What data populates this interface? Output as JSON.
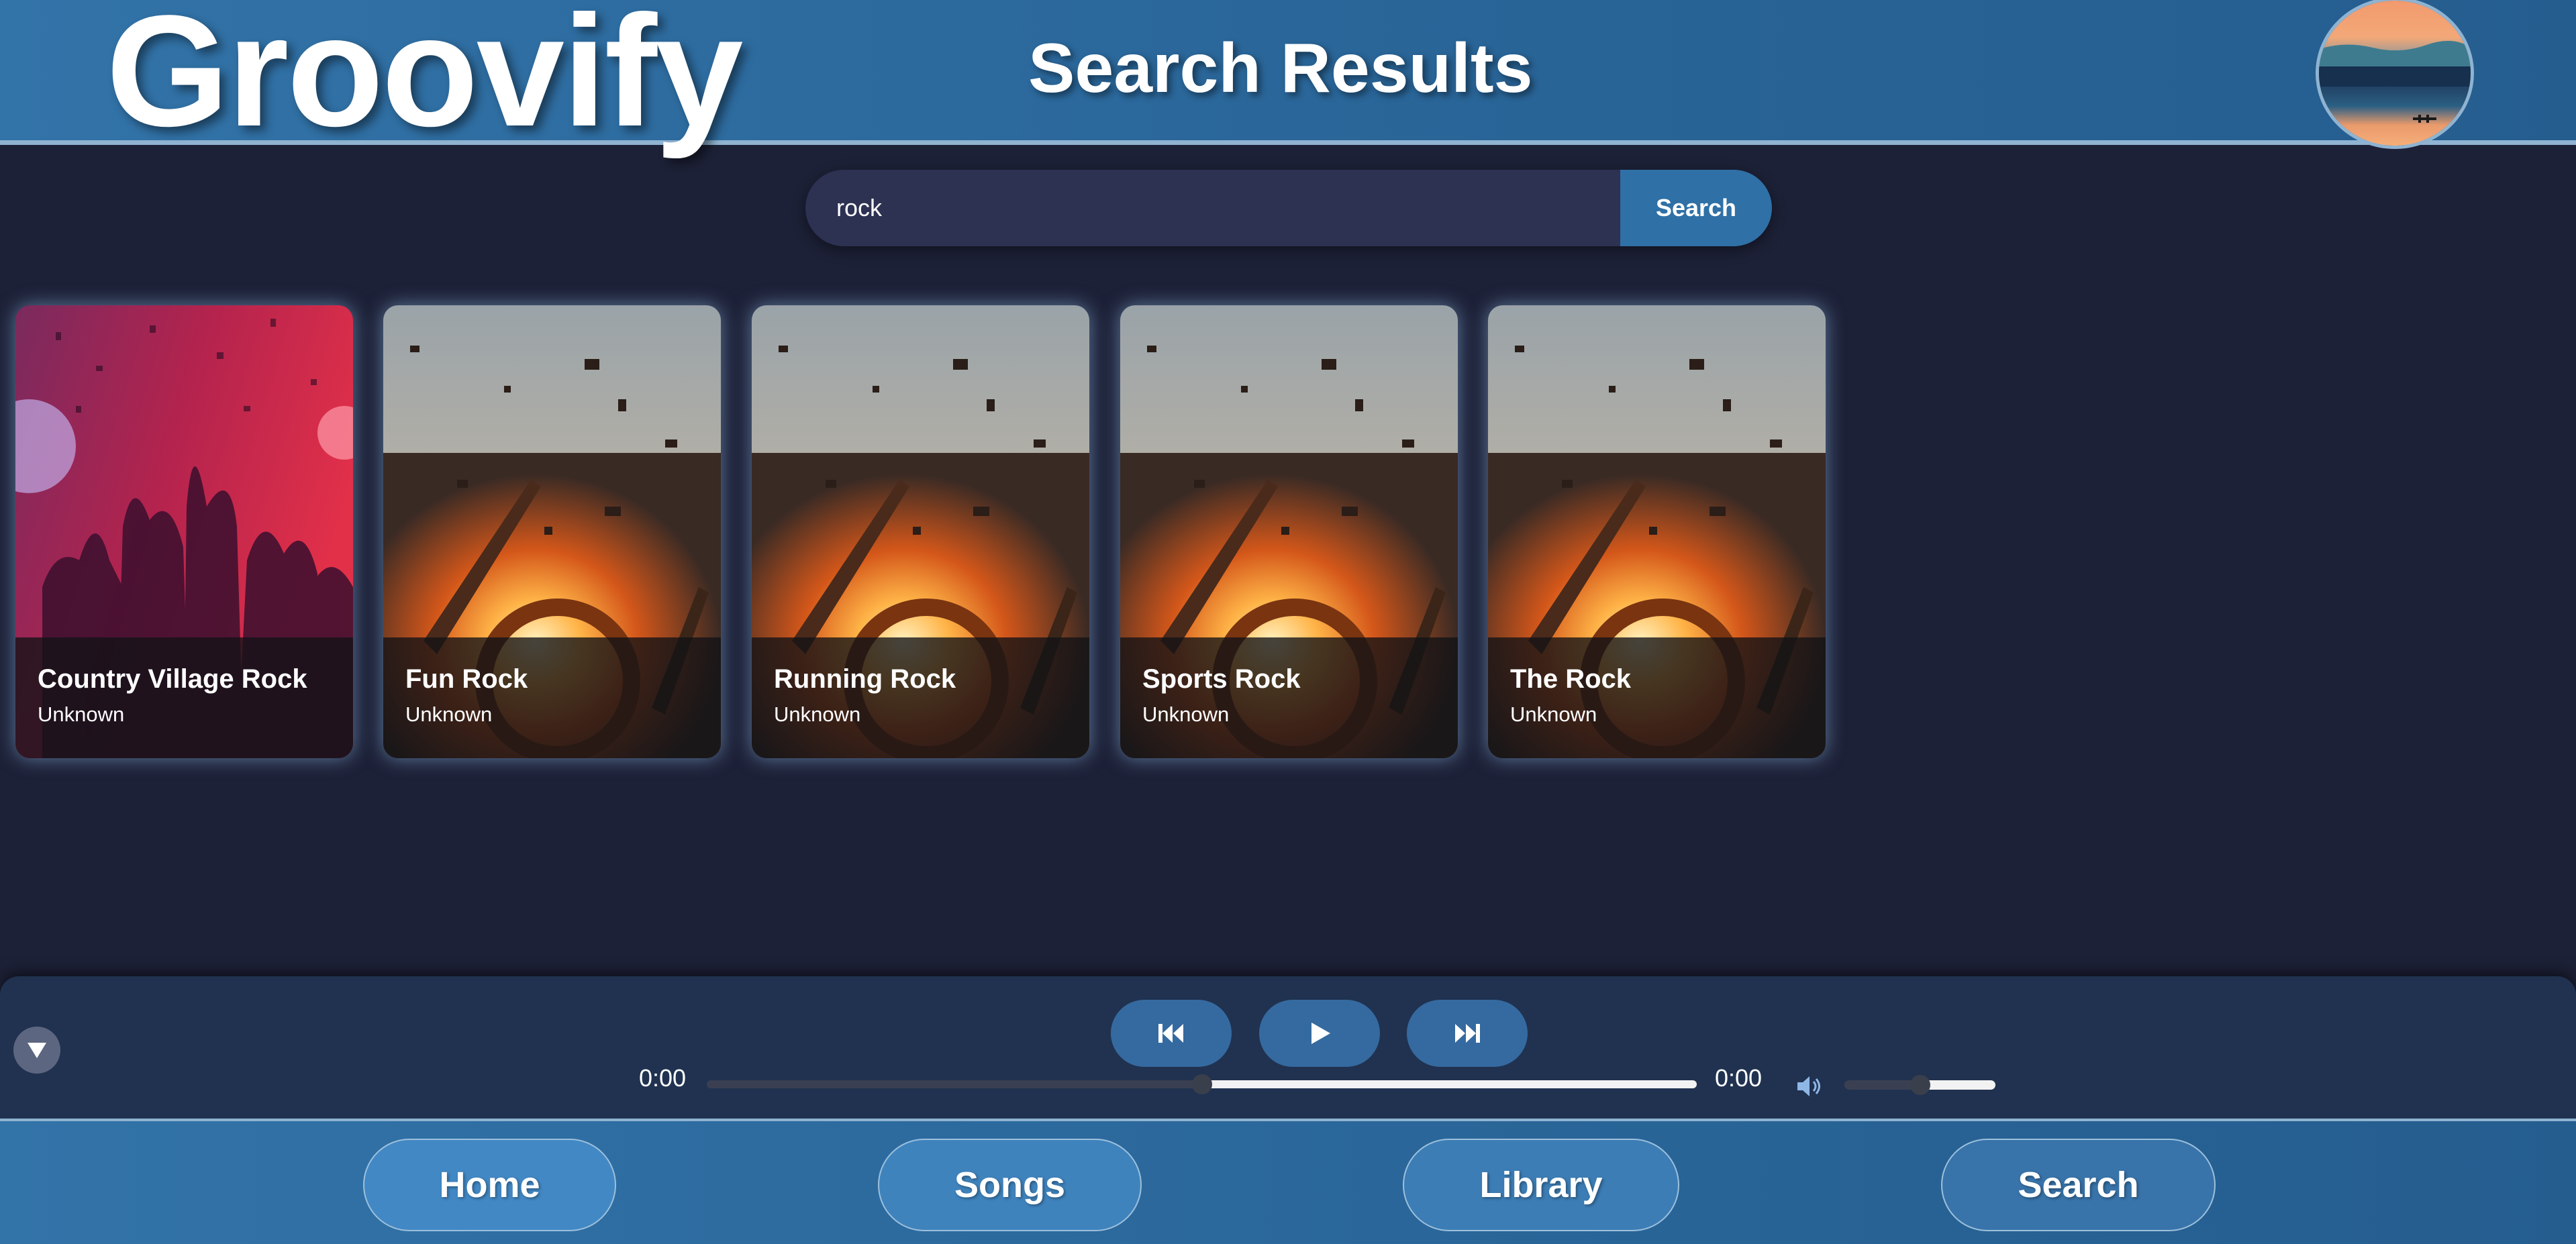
{
  "header": {
    "logo": "Groovify",
    "title": "Search Results",
    "avatar_icon": "avatar-sunset-lake"
  },
  "search": {
    "value": "rock",
    "button_label": "Search"
  },
  "results": [
    {
      "title": "Country Village Rock",
      "artist": "Unknown",
      "art": "crowd-concert"
    },
    {
      "title": "Fun Rock",
      "artist": "Unknown",
      "art": "exploding-guitar"
    },
    {
      "title": "Running Rock",
      "artist": "Unknown",
      "art": "exploding-guitar"
    },
    {
      "title": "Sports Rock",
      "artist": "Unknown",
      "art": "exploding-guitar"
    },
    {
      "title": "The Rock",
      "artist": "Unknown",
      "art": "exploding-guitar"
    }
  ],
  "player": {
    "current_time": "0:00",
    "duration": "0:00",
    "progress": 0.5,
    "volume": 0.5,
    "icons": [
      "chevron-down-icon",
      "previous-icon",
      "play-icon",
      "next-icon",
      "volume-icon"
    ]
  },
  "nav": {
    "home": "Home",
    "songs": "Songs",
    "library": "Library",
    "search": "Search"
  },
  "colors": {
    "background": "#1d2137",
    "header": "#2a6699",
    "accent": "#2f70a6",
    "player": "#203250"
  }
}
